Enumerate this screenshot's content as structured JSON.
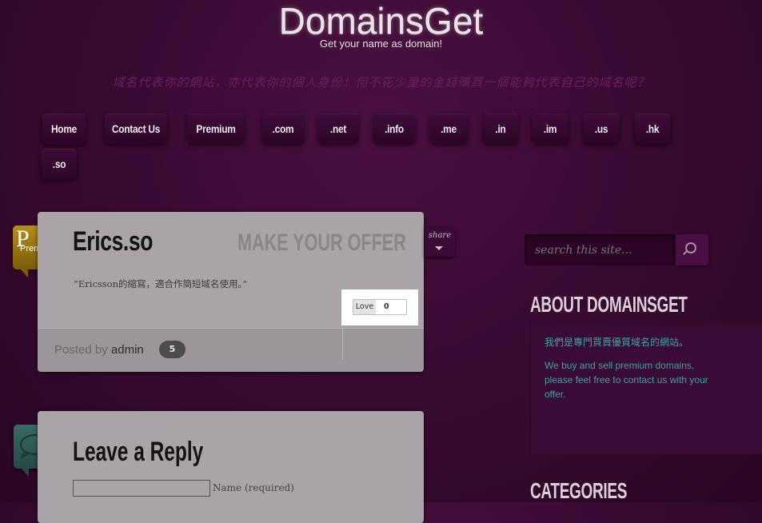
{
  "header": {
    "site_title": "DomainsGet",
    "tagline": "Get your name as domain!",
    "slogan": "域名代表你的網站，亦代表你的個人身份！何不花少量的金錢購買一個能夠代表自己的域名呢？"
  },
  "nav": {
    "items": [
      {
        "label": "Home"
      },
      {
        "label": "Contact Us"
      },
      {
        "label": "Premium"
      },
      {
        "label": ".com"
      },
      {
        "label": ".net"
      },
      {
        "label": ".info"
      },
      {
        "label": ".me"
      },
      {
        "label": ".in"
      },
      {
        "label": ".im"
      },
      {
        "label": ".us"
      },
      {
        "label": ".hk"
      },
      {
        "label": ".so"
      }
    ]
  },
  "post": {
    "category_badge": "Premium",
    "title": "Erics.so",
    "offer_label": "MAKE YOUR OFFER",
    "excerpt": "“Ericsson的縮寫，適合作簡短域名使用。”",
    "love_label": "Love",
    "love_count": "0",
    "posted_by_prefix": "Posted by",
    "author": "admin",
    "comment_count": "5",
    "share_label": "share"
  },
  "reply": {
    "title": "Leave a Reply",
    "name_label": "Name (required)",
    "name_value": ""
  },
  "sidebar": {
    "search_placeholder": "search this site...",
    "about_title": "ABOUT DOMAINSGET",
    "about_cn": "我們是專門買賣優質域名的網站。",
    "about_en": "We buy and sell premium domains, please feel free to contact us with your offer.",
    "categories_title": "CATEGORIES"
  },
  "colors": {
    "background": "#3a0b32",
    "accent_text": "#3aa4a1",
    "post_panel": "#aaa4a8"
  }
}
